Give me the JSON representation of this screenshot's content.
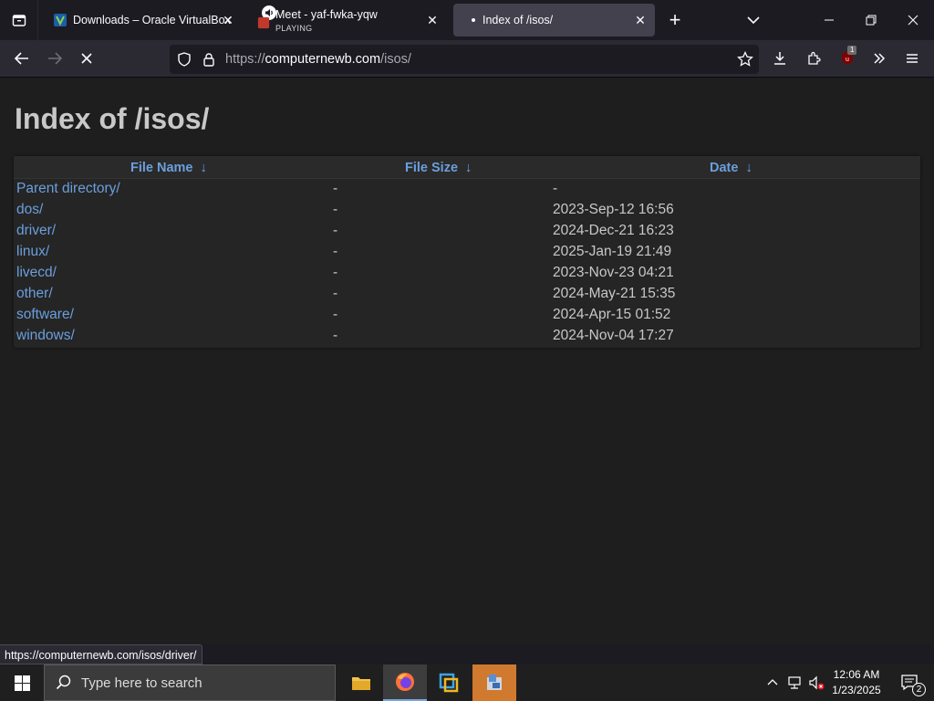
{
  "tabs": [
    {
      "title": "Downloads – Oracle VirtualBox",
      "active": false
    },
    {
      "title": "Meet - yaf-fwka-yqw",
      "subtitle": "PLAYING",
      "active": false
    },
    {
      "title": "Index of /isos/",
      "active": true
    }
  ],
  "navbar": {
    "url_scheme": "https://",
    "url_host": "computernewb.com",
    "url_path": "/isos/",
    "notification_count": "1"
  },
  "page": {
    "heading": "Index of /isos/",
    "columns": [
      {
        "label": "File Name",
        "sort": "↓"
      },
      {
        "label": "File Size",
        "sort": "↓"
      },
      {
        "label": "Date",
        "sort": "↓"
      }
    ],
    "rows": [
      {
        "name": "Parent directory/",
        "size": "-",
        "date": "-"
      },
      {
        "name": "dos/",
        "size": "-",
        "date": "2023-Sep-12 16:56"
      },
      {
        "name": "driver/",
        "size": "-",
        "date": "2024-Dec-21 16:23"
      },
      {
        "name": "linux/",
        "size": "-",
        "date": "2025-Jan-19 21:49"
      },
      {
        "name": "livecd/",
        "size": "-",
        "date": "2023-Nov-23 04:21"
      },
      {
        "name": "other/",
        "size": "-",
        "date": "2024-May-21 15:35"
      },
      {
        "name": "software/",
        "size": "-",
        "date": "2024-Apr-15 01:52"
      },
      {
        "name": "windows/",
        "size": "-",
        "date": "2024-Nov-04 17:27"
      }
    ]
  },
  "status_url": "https://computernewb.com/isos/driver/",
  "taskbar": {
    "search_placeholder": "Type here to search",
    "time": "12:06 AM",
    "date": "1/23/2025",
    "notifications": "2"
  },
  "colors": {
    "link": "#6b9fdd",
    "text": "#c8c8c8",
    "background": "#1e1e1e"
  }
}
